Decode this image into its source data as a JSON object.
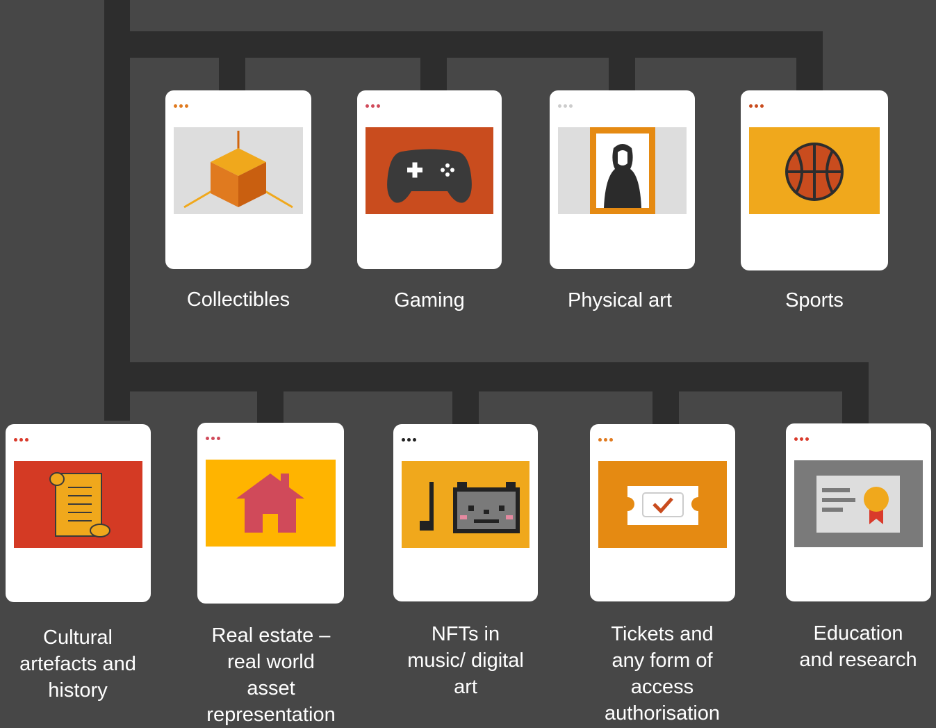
{
  "top_row": [
    {
      "label": "Collectibles",
      "icon": "cube-icon",
      "dot_color": "#e07a1f",
      "panel_color": "#dddddd"
    },
    {
      "label": "Gaming",
      "icon": "gamepad-icon",
      "dot_color": "#d04a5a",
      "panel_color": "#c94c1e"
    },
    {
      "label": "Physical art",
      "icon": "portrait-frame-icon",
      "dot_color": "#cccccc",
      "panel_color": "#dddddd"
    },
    {
      "label": "Sports",
      "icon": "basketball-icon",
      "dot_color": "#c94c1e",
      "panel_color": "#f0a81c"
    }
  ],
  "bottom_row": [
    {
      "label": "Cultural artefacts and history",
      "icon": "scroll-icon",
      "dot_color": "#d93a2b",
      "panel_color": "#d43a24"
    },
    {
      "label": "Real estate – real world asset representation",
      "icon": "house-icon",
      "dot_color": "#d04a5a",
      "panel_color": "#ffb400"
    },
    {
      "label": "NFTs in music/ digital art",
      "icon": "pixel-cat-music-icon",
      "dot_color": "#222222",
      "panel_color": "#f0a81c"
    },
    {
      "label": "Tickets and any form of access authorisation",
      "icon": "ticket-icon",
      "dot_color": "#e07a1f",
      "panel_color": "#e58a12"
    },
    {
      "label": "Education and research",
      "icon": "certificate-icon",
      "dot_color": "#d93a2b",
      "panel_color": "#7a7a7a"
    }
  ]
}
